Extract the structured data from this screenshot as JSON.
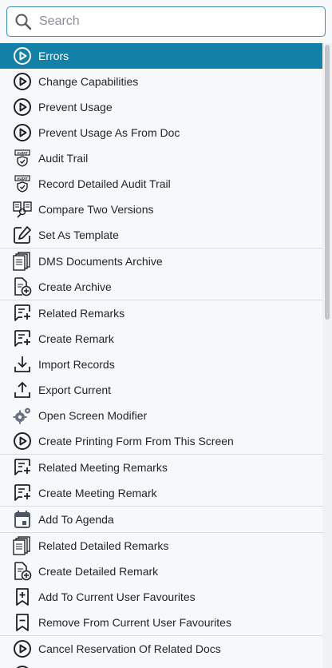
{
  "search": {
    "placeholder": "Search",
    "value": ""
  },
  "menu": {
    "items": [
      {
        "label": "Errors",
        "icon": "play-circle-icon",
        "active": true
      },
      {
        "label": "Change Capabilities",
        "icon": "play-circle-icon"
      },
      {
        "label": "Prevent Usage",
        "icon": "play-circle-icon"
      },
      {
        "label": "Prevent Usage As From Doc",
        "icon": "play-circle-icon"
      },
      {
        "label": "Audit Trail",
        "icon": "audit-icon"
      },
      {
        "label": "Record Detailed Audit Trail",
        "icon": "audit-icon"
      },
      {
        "label": "Compare Two Versions",
        "icon": "compare-icon"
      },
      {
        "label": "Set As Template",
        "icon": "edit-icon"
      },
      {
        "label": "DMS Documents Archive",
        "icon": "documents-stack-icon",
        "separator": true
      },
      {
        "label": "Create Archive",
        "icon": "document-add-icon"
      },
      {
        "label": "Related Remarks",
        "icon": "remark-icon",
        "separator": true
      },
      {
        "label": "Create Remark",
        "icon": "remark-add-icon"
      },
      {
        "label": "Import Records",
        "icon": "import-icon"
      },
      {
        "label": "Export Current",
        "icon": "export-icon"
      },
      {
        "label": "Open Screen Modifier",
        "icon": "gears-icon"
      },
      {
        "label": "Create Printing Form From This Screen",
        "icon": "play-circle-icon"
      },
      {
        "label": "Related Meeting Remarks",
        "icon": "remark-icon",
        "separator": true
      },
      {
        "label": "Create Meeting Remark",
        "icon": "remark-add-icon"
      },
      {
        "label": "Add To Agenda",
        "icon": "calendar-icon",
        "separator": true
      },
      {
        "label": "Related Detailed Remarks",
        "icon": "documents-stack-icon",
        "separator": true
      },
      {
        "label": "Create Detailed Remark",
        "icon": "document-add-icon"
      },
      {
        "label": "Add To Current User Favourites",
        "icon": "bookmark-add-icon"
      },
      {
        "label": "Remove From Current User Favourites",
        "icon": "bookmark-icon"
      },
      {
        "label": "Cancel Reservation Of Related Docs",
        "icon": "play-circle-icon",
        "separator": true
      },
      {
        "label": "",
        "icon": "play-circle-icon"
      }
    ]
  },
  "colors": {
    "accent": "#1380a8",
    "border": "#3b8fb0",
    "text": "#1f2328"
  }
}
